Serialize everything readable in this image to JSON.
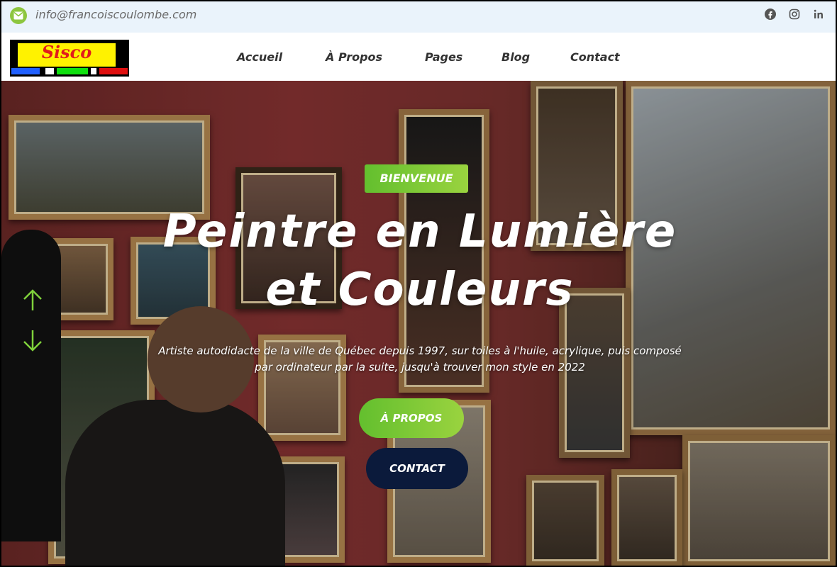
{
  "topbar": {
    "email": "info@francoiscoulombe.com",
    "email_icon": "mail-icon",
    "social": [
      {
        "name": "facebook-icon",
        "glyph": "f"
      },
      {
        "name": "instagram-icon",
        "glyph": "◎"
      },
      {
        "name": "linkedin-icon",
        "glyph": "in"
      }
    ]
  },
  "logo": {
    "text": "Sisco"
  },
  "nav": {
    "items": [
      "Accueil",
      "À Propos",
      "Pages",
      "Blog",
      "Contact"
    ]
  },
  "hero": {
    "badge": "BIENVENUE",
    "title_line1": "Peintre en Lumière",
    "title_line2": "et Couleurs",
    "subtitle_line1": "Artiste autodidacte de la ville de Québec depuis 1997, sur toiles à l'huile, acrylique, puis composé",
    "subtitle_line2": "par ordinateur par la suite, jusqu'à trouver mon style en 2022",
    "btn_about": "À PROPOS",
    "btn_contact": "CONTACT"
  },
  "colors": {
    "accent_green": "#8dc63f",
    "dark_navy": "#0b1a3b",
    "topbar_bg": "#eaf3fb"
  }
}
